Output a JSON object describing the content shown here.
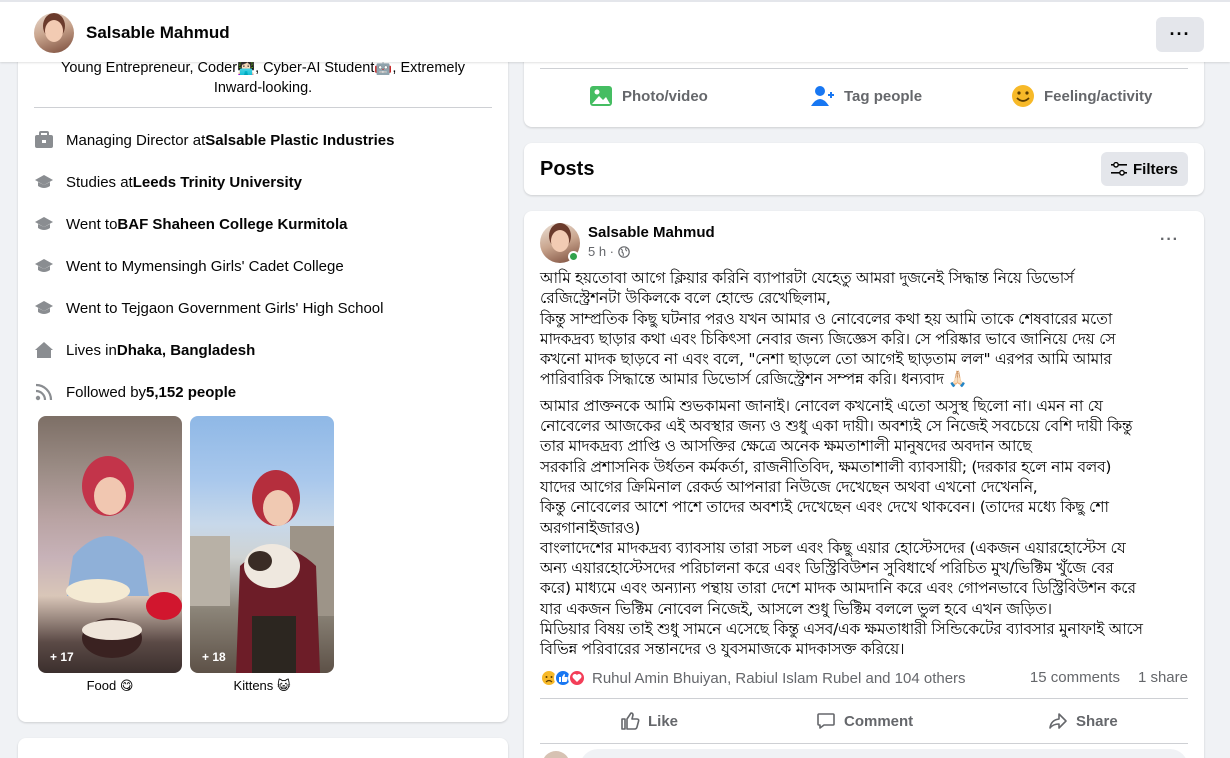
{
  "header": {
    "name": "Salsable Mahmud",
    "more": "···"
  },
  "intro": {
    "bio_line1": "Young Entrepreneur, Coder👩🏻‍💻, Cyber-AI Student🤖, Extremely",
    "bio_line2": "Inward-looking.",
    "items": [
      {
        "icon": "briefcase-icon",
        "prefix": "Managing Director at ",
        "bold": "Salsable Plastic Industries"
      },
      {
        "icon": "graduation-cap-icon",
        "prefix": "Studies at ",
        "bold": "Leeds Trinity University"
      },
      {
        "icon": "graduation-cap-icon",
        "prefix": "Went to ",
        "bold": "BAF Shaheen College Kurmitola"
      },
      {
        "icon": "graduation-cap-icon",
        "prefix": "Went to Mymensingh Girls' Cadet College",
        "bold": ""
      },
      {
        "icon": "graduation-cap-icon",
        "prefix": "Went to Tejgaon Government Girls' High School",
        "bold": ""
      },
      {
        "icon": "home-icon",
        "prefix": "Lives in ",
        "bold": "Dhaka, Bangladesh"
      },
      {
        "icon": "rss-icon",
        "prefix": "Followed by ",
        "bold": "5,152 people"
      }
    ],
    "albums": [
      {
        "count": "+ 17",
        "label": "Food 😋"
      },
      {
        "count": "+ 18",
        "label": "Kittens 😺"
      }
    ]
  },
  "composer": {
    "photo": "Photo/video",
    "tag": "Tag people",
    "feeling": "Feeling/activity"
  },
  "posts_header": {
    "title": "Posts",
    "filters": "Filters"
  },
  "post": {
    "author": "Salsable Mahmud",
    "time": "5 h ·",
    "more": "···",
    "paragraph1": "আমি হয়তোবা আগে ক্লিয়ার করিনি ব্যাপারটা যেহেতু আমরা দুজনেই সিদ্ধান্ত নিয়ে ডিভোর্স\nরেজিস্ট্রেশনটা উকিলকে বলে হোল্ডে রেখেছিলাম,\nকিন্তু সাম্প্রতিক কিছু ঘটনার পরও যখন আমার ও নোবেলের কথা হয় আমি তাকে শেষবারের মতো\nমাদকদ্রব্য ছাড়ার কথা এবং চিকিৎসা নেবার জন্য জিজ্ঞেস করি। সে পরিষ্কার ভাবে জানিয়ে দেয় সে\nকখনো মাদক ছাড়বে না এবং বলে, \"নেশা ছাড়লে তো আগেই ছাড়তাম লল\" এরপর আমি আমার\nপারিবারিক সিদ্ধান্তে আমার ডিভোর্স রেজিস্ট্রেশন সম্পন্ন করি। ধন্যবাদ 🙏🏻",
    "paragraph2": "আমার প্রাক্তনকে আমি শুভকামনা জানাই। নোবেল কখনোই এতো অসুস্থ ছিলো না। এমন না যে\nনোবেলের আজকের এই অবস্থার জন্য ও শুধু একা দায়ী। অবশ্যই সে নিজেই সবচেয়ে বেশি দায়ী কিন্তু\nতার মাদকদ্রব্য প্রাপ্তি ও আসক্তির ক্ষেত্রে অনেক ক্ষমতাশালী মানুষদের অবদান আছে\nসরকারি প্রশাসনিক উর্ধতন কর্মকর্তা, রাজনীতিবিদ, ক্ষমতাশালী ব্যাবসায়ী; (দরকার হলে নাম বলব)\nযাদের আগের ক্রিমিনাল রেকর্ড আপনারা নিউজে দেখেছেন অথবা এখনো দেখেননি,\nকিন্তু নোবেলের আশে পাশে তাদের অবশ্যই দেখেছেন এবং দেখে থাকবেন। (তাদের মধ্যে কিছু শো\nঅরগানাইজারও)\nবাংলাদেশের মাদকদ্রব্য ব্যাবসায় তারা সচল এবং কিছু এয়ার হোস্টেসদের (একজন এয়ারহোস্টেস যে\nঅন্য এয়ারহোস্টেসদের পরিচালনা করে এবং ডিস্ট্রিবিউশন সুবিধার্থে পরিচিত মুখ/ভিক্টিম খুঁজে বের\nকরে) মাধ্যমে এবং অন্যান্য পন্থায় তারা দেশে মাদক আমদানি করে এবং গোপনভাবে ডিস্ট্রিবিউশন করে\nযার একজন ভিক্টিম নোবেল নিজেই, আসলে শুধু ভিক্টিম বললে ভুল হবে এখন জড়িত।\nমিডিয়ার বিষয় তাই শুধু সামনে এসেছে কিন্তু এসব/এক ক্ষমতাধারী সিন্ডিকেটের ব্যাবসার মুনাফাই আসে\nবিভিন্ন পরিবারের সন্তানদের ও যুবসমাজকে মাদকাসক্ত করিয়ে।",
    "reactions_text": "Ruhul Amin Bhuiyan, Rabiul Islam Rubel and 104 others",
    "comments": "15 comments",
    "shares": "1 share",
    "like": "Like",
    "comment": "Comment",
    "share": "Share"
  },
  "colors": {
    "accent": "#1877f2",
    "secondary_text": "#65676b",
    "background": "#f0f2f5"
  }
}
